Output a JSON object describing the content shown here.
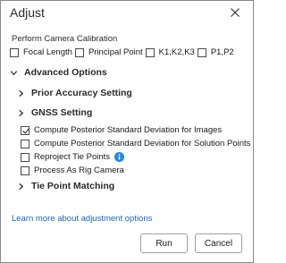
{
  "dialog": {
    "title": "Adjust"
  },
  "calibration": {
    "label": "Perform Camera Calibration",
    "options": [
      {
        "label": "Focal Length",
        "checked": false
      },
      {
        "label": "Principal Point",
        "checked": false
      },
      {
        "label": "K1,K2,K3",
        "checked": false
      },
      {
        "label": "P1,P2",
        "checked": false
      }
    ]
  },
  "advanced": {
    "label": "Advanced Options",
    "expanded": true,
    "prior_accuracy": "Prior Accuracy Setting",
    "gnss": "GNSS Setting",
    "options": [
      {
        "label": "Compute Posterior Standard Deviation for Images",
        "checked": true
      },
      {
        "label": "Compute Posterior Standard Deviation for Solution Points",
        "checked": false
      },
      {
        "label": "Reproject Tie Points",
        "checked": false
      },
      {
        "label": "Process As Rig Camera",
        "checked": false
      }
    ],
    "tie_point": "Tie Point Matching"
  },
  "link": {
    "label": "Learn more about adjustment options"
  },
  "buttons": {
    "run": "Run",
    "cancel": "Cancel"
  },
  "colors": {
    "link": "#1565c0",
    "info_icon": "#1e88e5"
  }
}
